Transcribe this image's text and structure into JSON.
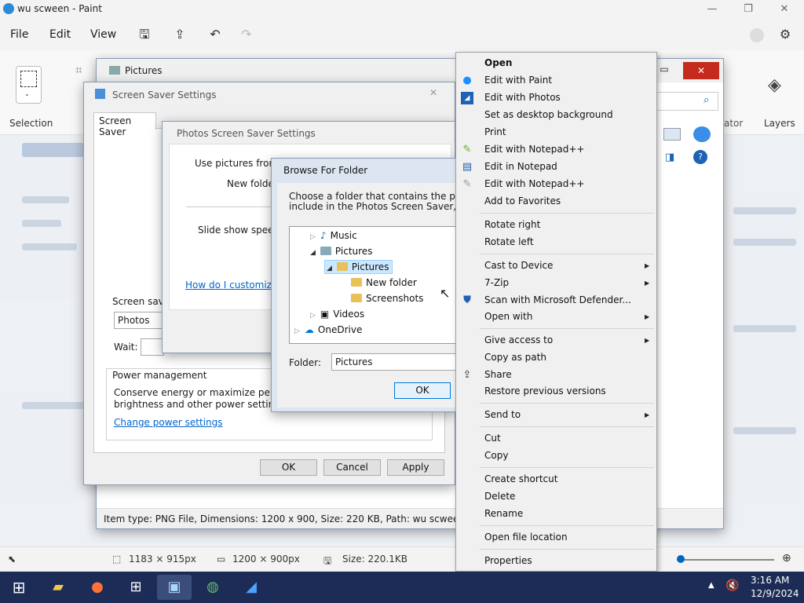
{
  "paint": {
    "title": "wu scween - Paint",
    "menu": [
      "File",
      "Edit",
      "View"
    ],
    "ribbon": {
      "selection": "Selection",
      "creator": "ator",
      "layers": "Layers"
    },
    "status": {
      "cursor": "1183 × 915px",
      "selection_size": "1200 × 900px",
      "file_size": "Size: 220.1KB"
    }
  },
  "explorer": {
    "title": "Pictures",
    "status": "Item type: PNG File, Dimensions: 1200 x 900, Size: 220 KB, Path: wu scween (C:\\Users\\A"
  },
  "screensaver": {
    "title": "Screen Saver Settings",
    "tab": "Screen Saver",
    "group_label": "Screen save",
    "selected": "Photos",
    "wait_label": "Wait:",
    "power_group": "Power management",
    "power_text_1": "Conserve energy or maximize perform",
    "power_text_2": "brightness and other power settings.",
    "power_link": "Change power settings",
    "ok": "OK",
    "cancel": "Cancel",
    "apply": "Apply"
  },
  "photos_settings": {
    "title": "Photos Screen Saver Settings",
    "use_pictures": "Use pictures from:",
    "new_folder": "New folder",
    "speed": "Slide show speed:",
    "help_link": "How do I customize"
  },
  "browse": {
    "title": "Browse For Folder",
    "desc_1": "Choose a folder that contains the pictures y",
    "desc_2": "include in the Photos Screen Saver, and ther",
    "tree": [
      "Music",
      "Pictures",
      "Pictures",
      "New folder",
      "Screenshots",
      "Videos",
      "OneDrive"
    ],
    "folder_label": "Folder:",
    "folder_value": "Pictures",
    "ok": "OK"
  },
  "context_menu": {
    "open": "Open",
    "edit_paint": "Edit with Paint",
    "edit_photos": "Edit with Photos",
    "desktop_bg": "Set as desktop background",
    "print": "Print",
    "notepadpp_1": "Edit with Notepad++",
    "notepad": "Edit in Notepad",
    "notepadpp_2": "Edit with Notepad++",
    "favorites": "Add to Favorites",
    "rotate_right": "Rotate right",
    "rotate_left": "Rotate left",
    "cast": "Cast to Device",
    "zip": "7-Zip",
    "defender": "Scan with Microsoft Defender...",
    "open_with": "Open with",
    "give_access": "Give access to",
    "copy_path": "Copy as path",
    "share": "Share",
    "restore": "Restore previous versions",
    "send_to": "Send to",
    "cut": "Cut",
    "copy": "Copy",
    "shortcut": "Create shortcut",
    "delete": "Delete",
    "rename": "Rename",
    "file_location": "Open file location",
    "properties": "Properties"
  },
  "taskbar": {
    "time": "3:16 AM",
    "date": "12/9/2024"
  }
}
